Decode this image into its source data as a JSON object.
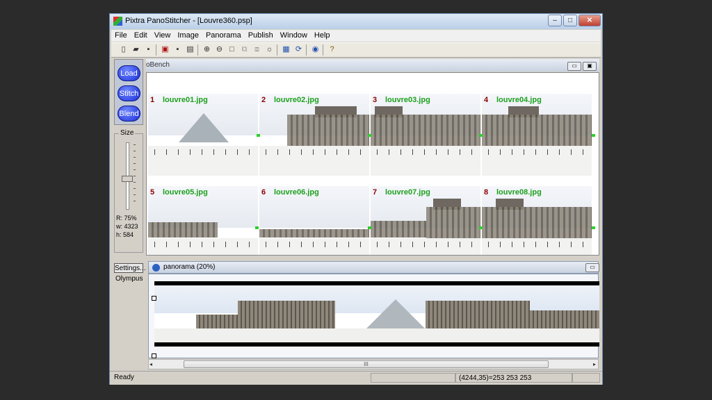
{
  "window": {
    "title": "Pixtra PanoStitcher - [Louvre360.psp]",
    "minimize": "–",
    "maximize": "□",
    "close": "✕"
  },
  "menu": [
    "File",
    "Edit",
    "View",
    "Image",
    "Panorama",
    "Publish",
    "Window",
    "Help"
  ],
  "toolbar": {
    "icons": [
      "new-icon",
      "open-icon",
      "save-icon",
      "save-tiff-icon",
      "save-jpeg-icon",
      "print-icon",
      "zoom-in-icon",
      "zoom-out-icon",
      "fit-icon",
      "tile-icon",
      "grid-icon",
      "brightness-icon",
      "stitch-icon",
      "rotate-icon",
      "publish-icon",
      "help-icon"
    ]
  },
  "sidebar": {
    "buttons": [
      "Load",
      "Stitch",
      "Blend"
    ],
    "size_label": "Size",
    "slider_level": 0.55,
    "r": "R: 75%",
    "w": "w: 4323",
    "h": "h: 584",
    "settings": "Settings...",
    "camera": "Olympus"
  },
  "workbench": {
    "title": "oBench",
    "images": [
      {
        "num": "1",
        "name": "louvre01.jpg"
      },
      {
        "num": "2",
        "name": "louvre02.jpg"
      },
      {
        "num": "3",
        "name": "louvre03.jpg"
      },
      {
        "num": "4",
        "name": "louvre04.jpg"
      },
      {
        "num": "5",
        "name": "louvre05.jpg"
      },
      {
        "num": "6",
        "name": "louvre06.jpg"
      },
      {
        "num": "7",
        "name": "louvre07.jpg"
      },
      {
        "num": "8",
        "name": "louvre08.jpg"
      }
    ]
  },
  "panorama": {
    "title": "panorama (20%)"
  },
  "scrollbar": {
    "grip": "III"
  },
  "status": {
    "left": "Ready",
    "pixel": "(4244,35)=253 253 253"
  },
  "colors": {
    "accent": "#1a2fd8",
    "filename": "#1ca01c",
    "number": "#8b0000"
  }
}
